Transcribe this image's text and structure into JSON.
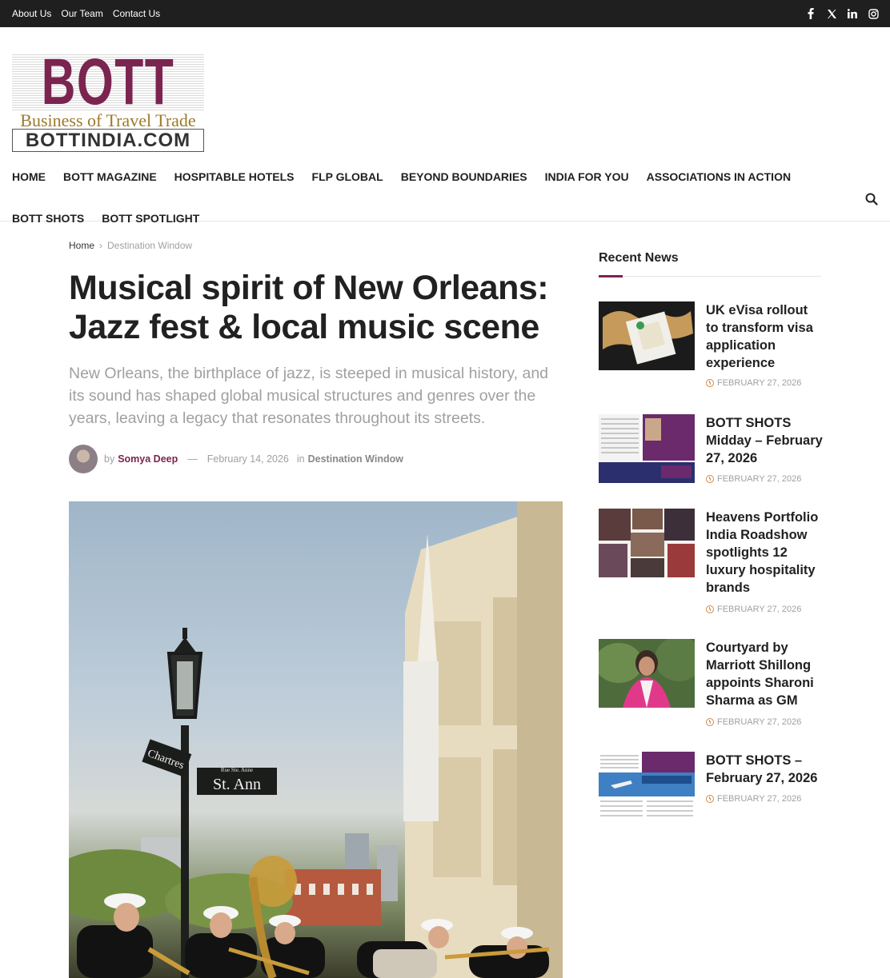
{
  "topbar": {
    "links": [
      "About Us",
      "Our Team",
      "Contact Us"
    ],
    "social_icons": [
      "facebook-icon",
      "x-twitter-icon",
      "linkedin-icon",
      "instagram-icon"
    ]
  },
  "logo": {
    "brand": "BOTT",
    "tagline": "Business of Travel Trade",
    "domain": "BOTTINDIA.COM"
  },
  "nav": {
    "row1": [
      "HOME",
      "BOTT MAGAZINE",
      "HOSPITABLE HOTELS",
      "FLP GLOBAL",
      "BEYOND BOUNDARIES",
      "INDIA FOR YOU",
      "ASSOCIATIONS IN ACTION"
    ],
    "row2": [
      "BOTT SHOTS",
      "BOTT SPOTLIGHT"
    ]
  },
  "breadcrumb": {
    "home": "Home",
    "separator": "›",
    "current": "Destination Window"
  },
  "article": {
    "title": "Musical spirit of New Orleans: Jazz fest & local music scene",
    "subtitle": "New Orleans, the birthplace of jazz, is steeped in musical history, and its sound has shaped global musical structures and genres over the years, leaving a legacy that resonates throughout its streets.",
    "by_label": "by",
    "author": "Somya Deep",
    "dash": "—",
    "date": "February 14, 2026",
    "in_label": "in",
    "category": "Destination Window",
    "street_sign_1": "St. Ann",
    "street_sign_2": "Chartres",
    "street_sign_small": "Rue Ste. Anne"
  },
  "sidebar": {
    "title": "Recent News",
    "items": [
      {
        "headline": "UK eVisa rollout to transform visa application experience",
        "date": "FEBRUARY 27, 2026"
      },
      {
        "headline": "BOTT SHOTS Midday – February 27, 2026",
        "date": "FEBRUARY 27, 2026"
      },
      {
        "headline": "Heavens Portfolio India Roadshow spotlights 12 luxury hospitality brands",
        "date": "FEBRUARY 27, 2026"
      },
      {
        "headline": "Courtyard by Marriott Shillong appoints Sharoni Sharma as GM",
        "date": "FEBRUARY 27, 2026"
      },
      {
        "headline": "BOTT SHOTS – February 27, 2026",
        "date": "FEBRUARY 27, 2026"
      }
    ]
  },
  "colors": {
    "brand": "#7b2450",
    "gold": "#9c7a2a",
    "topbar": "#1f1f1f",
    "clock": "#d58a45"
  }
}
